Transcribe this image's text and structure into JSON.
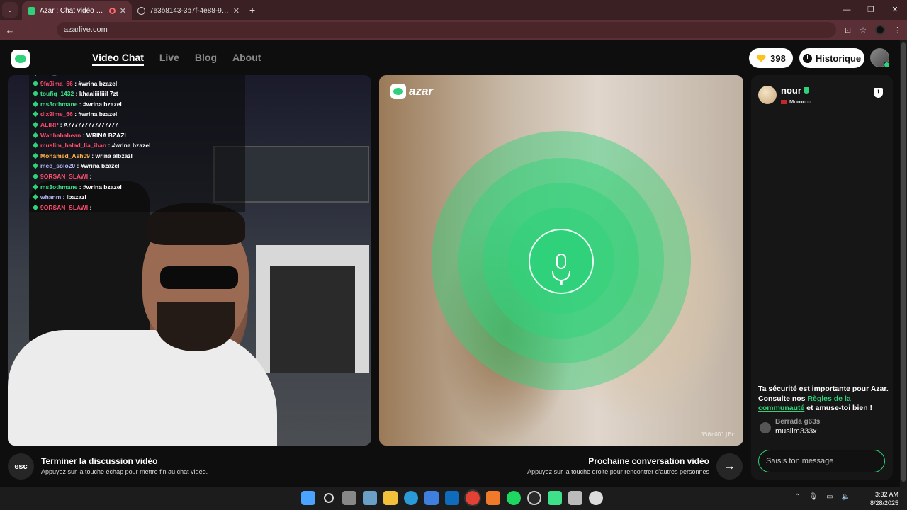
{
  "browser": {
    "tabs": [
      {
        "title": "Azar : Chat vidéo avec de n",
        "active": true
      },
      {
        "title": "7e3b8143-3b7f-4e88-99f5-626",
        "active": false
      }
    ],
    "new_tab": "+",
    "url": "azarlive.com"
  },
  "nav": {
    "links": [
      "Video Chat",
      "Live",
      "Blog",
      "About"
    ],
    "active": "Video Chat"
  },
  "header": {
    "gems": "398",
    "history_label": "Historique"
  },
  "stream_chat": [
    {
      "user": "med_solo20",
      "msg": "#wrina bzazel",
      "color": "#b8b8ff"
    },
    {
      "user": "9fa9ima_66",
      "msg": "#wrina bzazel",
      "color": "#ff4d6d"
    },
    {
      "user": "toufiq_1432",
      "msg": "khaaliiiliiil 7zt",
      "color": "#3fe08a"
    },
    {
      "user": "ms3othmane",
      "msg": "#wrina bzazel",
      "color": "#3fe08a"
    },
    {
      "user": "dix9ime_66",
      "msg": "#wrina bzazel",
      "color": "#ff4d6d"
    },
    {
      "user": "ALIRP",
      "msg": "A777777777777777",
      "color": "#ff4d6d"
    },
    {
      "user": "Wahhahahean",
      "msg": "WRINA BZAZL",
      "color": "#ff4d6d"
    },
    {
      "user": "muslim_halad_lia_iban",
      "msg": "#wrina bzazel",
      "color": "#ff4d6d"
    },
    {
      "user": "Mohamed_Ash09",
      "msg": "wrina albzazl",
      "color": "#ffb347"
    },
    {
      "user": "med_solo20",
      "msg": "#wrina bzazel",
      "color": "#b8b8ff"
    },
    {
      "user": "9ORSAN_SLAWI",
      "msg": "",
      "color": "#ff4d6d"
    },
    {
      "user": "ms3othmane",
      "msg": "#wrina bzazel",
      "color": "#3fe08a"
    },
    {
      "user": "whanm",
      "msg": "lbazazl",
      "color": "#b8b8ff"
    },
    {
      "user": "9ORSAN_SLAWI",
      "msg": "",
      "color": "#ff4d6d"
    }
  ],
  "partner_video": {
    "brand": "azar",
    "session_id": "356r0D1jEc"
  },
  "controls": {
    "esc_key": "esc",
    "end_title": "Terminer la discussion vidéo",
    "end_sub": "Appuyez sur la touche échap pour mettre fin au chat vidéo.",
    "next_title": "Prochaine conversation vidéo",
    "next_sub": "Appuyez sur la touche droite pour rencontrer d'autres personnes",
    "next_arrow": "→"
  },
  "partner": {
    "name": "nour",
    "country": "Morocco"
  },
  "safety": {
    "pre": "Ta sécurité est importante pour Azar. Consulte nos ",
    "link": "Règles de la communauté",
    "post": " et amuse-toi bien !"
  },
  "message": {
    "user": "Berrada g63s",
    "text": "muslim333x"
  },
  "input": {
    "placeholder": "Saisis ton message"
  },
  "taskbar": {
    "time": "3:32 AM",
    "date": "8/28/2025"
  },
  "colors": {
    "accent": "#2fd27a",
    "tab_bg": "#3a1f23",
    "panel_bg": "#161616"
  }
}
